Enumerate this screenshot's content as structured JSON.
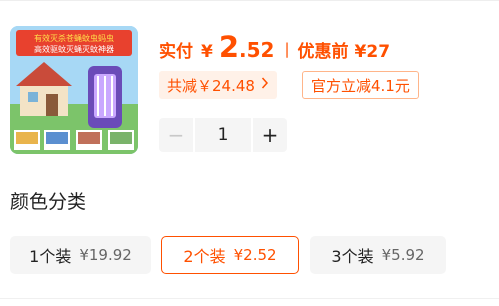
{
  "product": {
    "image_icon": "product-image-mosquito-lamp",
    "banner_line1": "有效灭杀苍蝇蚊虫蚂虫",
    "banner_line2": "高效驱蚊灭蝇灭蚊神器",
    "colors": {
      "accent": "#ff5000",
      "tag_bg": "#fff1e8",
      "tag_border": "#ffb58a"
    }
  },
  "price": {
    "paid_label": "实付",
    "currency": "¥",
    "paid_integer": "2",
    "paid_decimal": ".52",
    "separator": "|",
    "original_label": "优惠前",
    "original_value": "27"
  },
  "tags": {
    "total_saved": "共减￥24.48",
    "chevron_icon": "chevron-right-icon",
    "official": "官方立减4.1元"
  },
  "stepper": {
    "minus": "−",
    "quantity": "1",
    "plus": "+"
  },
  "options_section": {
    "title": "颜色分类",
    "items": [
      {
        "label": "1个装",
        "price": "¥19.92",
        "selected": false
      },
      {
        "label": "2个装",
        "price": "¥2.52",
        "selected": true
      },
      {
        "label": "3个装",
        "price": "¥5.92",
        "selected": false
      }
    ]
  }
}
